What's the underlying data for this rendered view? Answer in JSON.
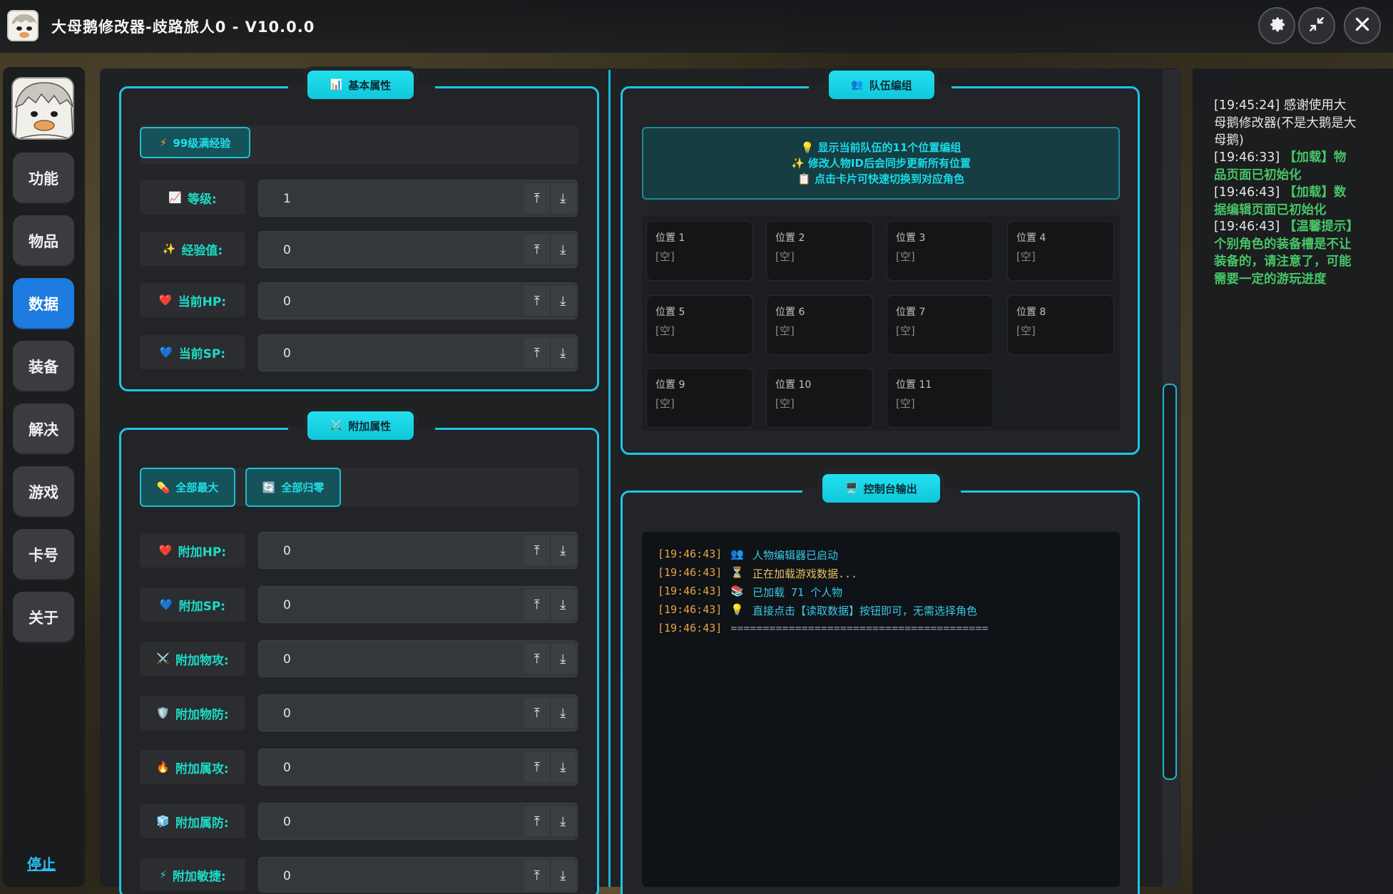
{
  "titlebar": {
    "title": "大母鹅修改器-歧路旅人0 - V10.0.0",
    "settings_icon": "gear-icon",
    "compress_icon": "compress-arrows-icon",
    "close_icon": "close-icon"
  },
  "nav": {
    "items": [
      {
        "label": "功能"
      },
      {
        "label": "物品"
      },
      {
        "label": "数据"
      },
      {
        "label": "装备"
      },
      {
        "label": "解决"
      },
      {
        "label": "游戏"
      },
      {
        "label": "卡号"
      },
      {
        "label": "关于"
      }
    ],
    "active": "数据",
    "stop_label": "停止"
  },
  "basic": {
    "tab_label": "基本属性",
    "max_exp_button": "99级满经验",
    "rows": [
      {
        "label": "等级:",
        "value": "1",
        "icon": "chart-icon"
      },
      {
        "label": "经验值:",
        "value": "0",
        "icon": "sparkle-icon"
      },
      {
        "label": "当前HP:",
        "value": "0",
        "icon": "red-heart-icon"
      },
      {
        "label": "当前SP:",
        "value": "0",
        "icon": "blue-heart-icon"
      }
    ]
  },
  "extra": {
    "tab_label": "附加属性",
    "max_all_button": "全部最大",
    "reset_all_button": "全部归零",
    "rows": [
      {
        "label": "附加HP:",
        "value": "0",
        "icon": "red-heart-icon"
      },
      {
        "label": "附加SP:",
        "value": "0",
        "icon": "blue-heart-icon"
      },
      {
        "label": "附加物攻:",
        "value": "0",
        "icon": "crossed-swords-icon"
      },
      {
        "label": "附加物防:",
        "value": "0",
        "icon": "shield-icon"
      },
      {
        "label": "附加属攻:",
        "value": "0",
        "icon": "fire-icon"
      },
      {
        "label": "附加属防:",
        "value": "0",
        "icon": "cube-icon"
      },
      {
        "label": "附加敏捷:",
        "value": "0",
        "icon": "lightning-icon"
      }
    ]
  },
  "team": {
    "tab_label": "队伍编组",
    "info": [
      "💡 显示当前队伍的11个位置编组",
      "✨ 修改人物ID后会同步更新所有位置",
      "📋 点击卡片可快速切换到对应角色"
    ],
    "slots": [
      {
        "name": "位置 1",
        "value": "[空]"
      },
      {
        "name": "位置 2",
        "value": "[空]"
      },
      {
        "name": "位置 3",
        "value": "[空]"
      },
      {
        "name": "位置 4",
        "value": "[空]"
      },
      {
        "name": "位置 5",
        "value": "[空]"
      },
      {
        "name": "位置 6",
        "value": "[空]"
      },
      {
        "name": "位置 7",
        "value": "[空]"
      },
      {
        "name": "位置 8",
        "value": "[空]"
      },
      {
        "name": "位置 9",
        "value": "[空]"
      },
      {
        "name": "位置 10",
        "value": "[空]"
      },
      {
        "name": "位置 11",
        "value": "[空]"
      }
    ]
  },
  "console": {
    "tab_label": "控制台输出",
    "lines": [
      {
        "ts": "[19:46:43]",
        "icon": "👥",
        "msg": "人物编辑器已启动"
      },
      {
        "ts": "[19:46:43]",
        "icon": "⏳",
        "msg": "正在加载游戏数据..."
      },
      {
        "ts": "[19:46:43]",
        "icon": "📚",
        "msg": "已加载 71 个人物"
      },
      {
        "ts": "[19:46:43]",
        "icon": "💡",
        "msg": "直接点击【读取数据】按钮即可，无需选择角色"
      },
      {
        "ts": "[19:46:43]",
        "icon": "",
        "msg": "========================================"
      }
    ]
  },
  "right_log": {
    "entries": [
      {
        "time": "[19:45:24]",
        "text": "感谢使用大母鹅修改器(不是大鹅是大母鹅)",
        "style": "plain"
      },
      {
        "time": "[19:46:33]",
        "text": "【加载】物品页面已初始化",
        "style": "green"
      },
      {
        "time": "[19:46:43]",
        "text": "【加载】数据编辑页面已初始化",
        "style": "green"
      },
      {
        "time": "[19:46:43]",
        "text": "【温馨提示】个别角色的装备槽是不让装备的，请注意了，可能需要一定的游玩进度",
        "style": "green"
      }
    ]
  },
  "colors": {
    "accent": "#1fc4e8",
    "nav_active": "#1e7be0",
    "label_text": "#1cdcc6",
    "console_ts": "#e8a445",
    "console_msg": "#38c8e8",
    "log_green": "#47c466"
  }
}
